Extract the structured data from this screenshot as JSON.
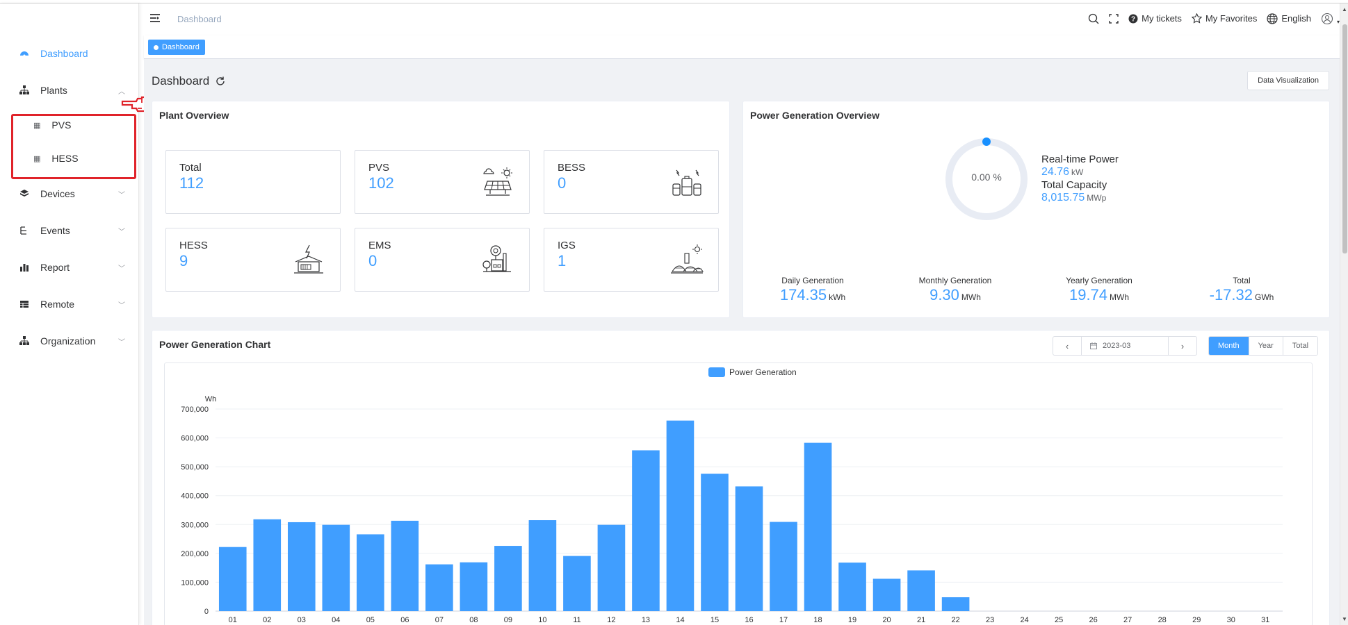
{
  "sidebar": {
    "items": [
      {
        "label": "Dashboard",
        "icon": "dashboard-icon",
        "active": true
      },
      {
        "label": "Plants",
        "icon": "sitemap-icon",
        "expanded": true,
        "children": [
          {
            "label": "PVS",
            "icon": "table-icon"
          },
          {
            "label": "HESS",
            "icon": "table-icon"
          }
        ]
      },
      {
        "label": "Devices",
        "icon": "cube-icon"
      },
      {
        "label": "Events",
        "icon": "tree-icon"
      },
      {
        "label": "Report",
        "icon": "bar-chart-icon"
      },
      {
        "label": "Remote",
        "icon": "grid-icon"
      },
      {
        "label": "Organization",
        "icon": "org-chart-icon"
      }
    ],
    "highlight_color": "#e0232a"
  },
  "header": {
    "breadcrumb": "Dashboard",
    "my_tickets": "My tickets",
    "my_favorites": "My Favorites",
    "language": "English"
  },
  "tags": {
    "active": "Dashboard"
  },
  "page": {
    "title": "Dashboard",
    "data_visualization": "Data Visualization"
  },
  "plant_overview": {
    "title": "Plant Overview",
    "tiles": [
      {
        "label": "Total",
        "value": "112"
      },
      {
        "label": "PVS",
        "value": "102",
        "icon": "solar-panel-icon"
      },
      {
        "label": "BESS",
        "value": "0",
        "icon": "battery-icon"
      },
      {
        "label": "HESS",
        "value": "9",
        "icon": "home-storage-icon"
      },
      {
        "label": "EMS",
        "value": "0",
        "icon": "ems-icon"
      },
      {
        "label": "IGS",
        "value": "1",
        "icon": "igs-icon"
      }
    ]
  },
  "power_overview": {
    "title": "Power Generation Overview",
    "donut_percent": "0.00 %",
    "realtime_label": "Real-time Power",
    "realtime_value": "24.76",
    "realtime_unit": "kW",
    "capacity_label": "Total Capacity",
    "capacity_value": "8,015.75",
    "capacity_unit": "MWp",
    "generation": [
      {
        "label": "Daily Generation",
        "value": "174.35",
        "unit": "kWh"
      },
      {
        "label": "Monthly Generation",
        "value": "9.30",
        "unit": "MWh"
      },
      {
        "label": "Yearly Generation",
        "value": "19.74",
        "unit": "MWh"
      },
      {
        "label": "Total",
        "value": "-17.32",
        "unit": "GWh"
      }
    ]
  },
  "generation_chart": {
    "title": "Power Generation Chart",
    "date": "2023-03",
    "periods": [
      "Month",
      "Year",
      "Total"
    ],
    "active_period": "Month"
  },
  "chart_data": {
    "type": "bar",
    "ylabel": "Wh",
    "ylim": [
      0,
      700000
    ],
    "yticks": [
      "0",
      "100,000",
      "200,000",
      "300,000",
      "400,000",
      "500,000",
      "600,000",
      "700,000"
    ],
    "categories": [
      "01",
      "02",
      "03",
      "04",
      "05",
      "06",
      "07",
      "08",
      "09",
      "10",
      "11",
      "12",
      "13",
      "14",
      "15",
      "16",
      "17",
      "18",
      "19",
      "20",
      "21",
      "22",
      "23",
      "24",
      "25",
      "26",
      "27",
      "28",
      "29",
      "30",
      "31"
    ],
    "series": [
      {
        "name": "Power Generation",
        "color": "#409eff",
        "values": [
          222000,
          318000,
          308000,
          299000,
          266000,
          313000,
          162000,
          169000,
          226000,
          315000,
          191000,
          299000,
          557000,
          660000,
          476000,
          432000,
          309000,
          583000,
          168000,
          112000,
          141000,
          48000,
          0,
          0,
          0,
          0,
          0,
          0,
          0,
          0,
          0
        ]
      }
    ],
    "grid": true,
    "legend": "top-center"
  }
}
